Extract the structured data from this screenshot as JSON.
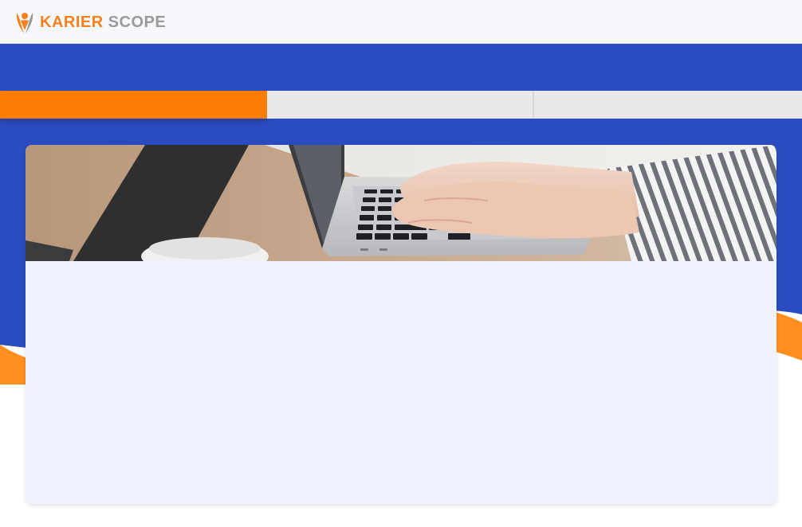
{
  "brand": {
    "name_part1": "KARIER",
    "name_part2": "SCOPE",
    "accent_color": "#f5821f",
    "secondary_color": "#9a9a9a",
    "logo_icon": "person-flame-logo-icon"
  },
  "theme": {
    "primary_blue": "#2a4cc0",
    "tab_active": "#ff7d06",
    "tab_inactive": "#e9e9e9",
    "card_bg": "#f0f3fd"
  },
  "tabs": [
    {
      "label": "",
      "active": true
    },
    {
      "label": "",
      "active": false
    },
    {
      "label": "",
      "active": false
    }
  ],
  "banner": {
    "subject": "hands-typing-on-laptop-image"
  }
}
